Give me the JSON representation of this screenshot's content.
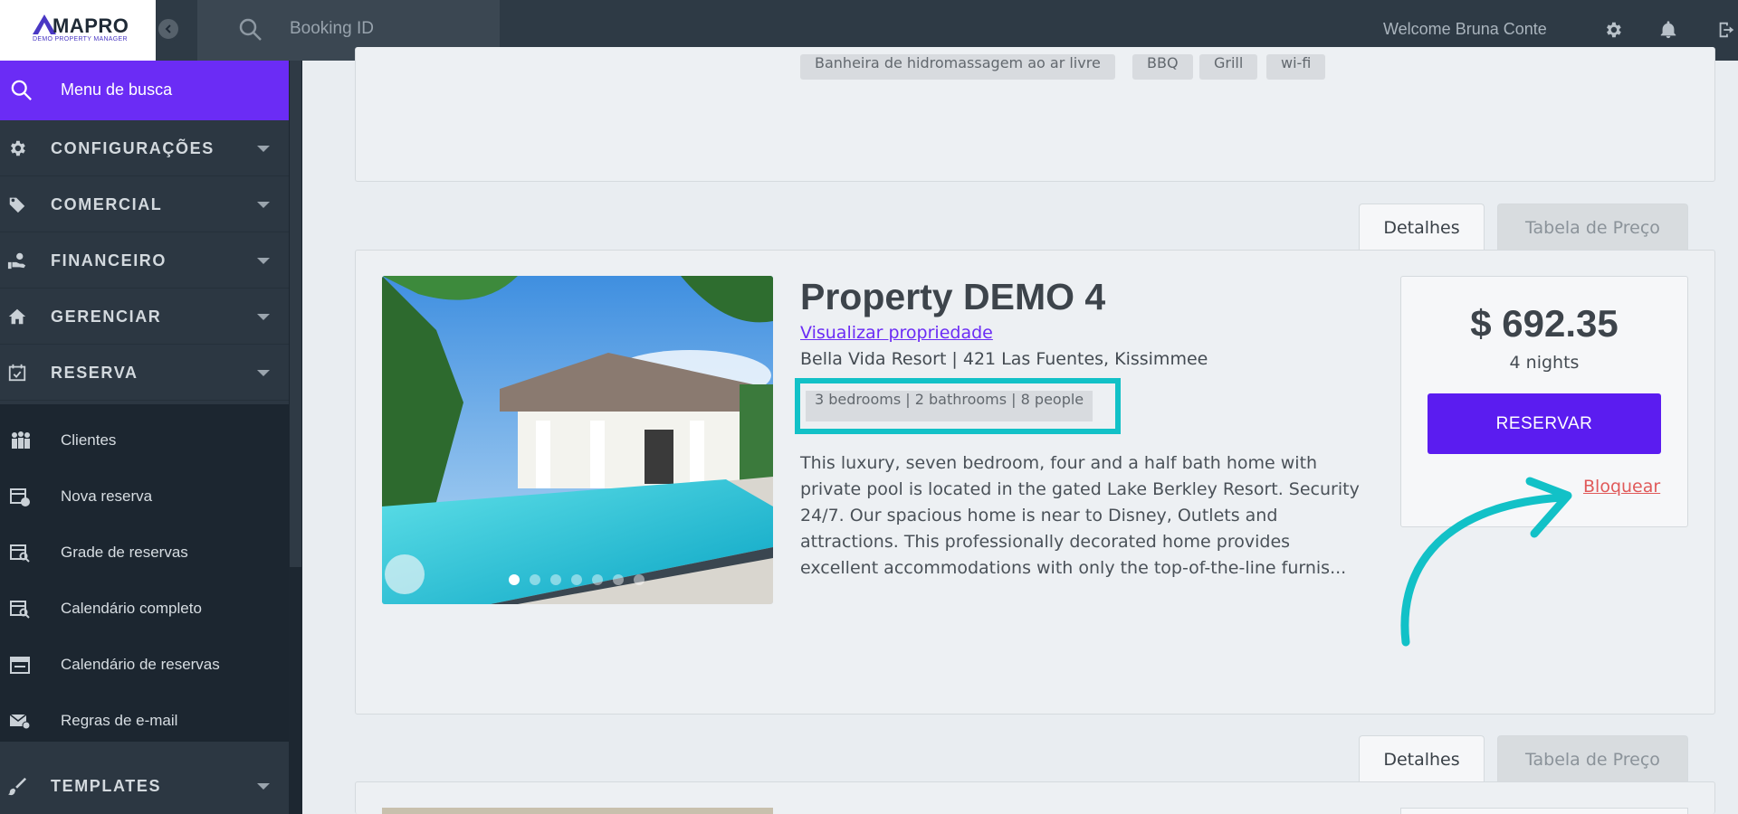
{
  "app": {
    "logo_text": "MAPRO",
    "logo_sub": "DEMO PROPERTY MANAGER",
    "search_placeholder": "Booking ID",
    "welcome": "Welcome Bruna Conte"
  },
  "sidebar": {
    "search_label": "Menu de busca",
    "sections": [
      {
        "label": "CONFIGURAÇÕES",
        "icon": "gear-icon"
      },
      {
        "label": "COMERCIAL",
        "icon": "tag-icon"
      },
      {
        "label": "FINANCEIRO",
        "icon": "money-hand-icon"
      },
      {
        "label": "GERENCIAR",
        "icon": "house-icon"
      },
      {
        "label": "RESERVA",
        "icon": "calendar-check-icon"
      }
    ],
    "sub_items": [
      {
        "label": "Clientes",
        "icon": "people-icon"
      },
      {
        "label": "Nova reserva",
        "icon": "calendar-plus-icon"
      },
      {
        "label": "Grade de reservas",
        "icon": "calendar-search-icon"
      },
      {
        "label": "Calendário completo",
        "icon": "calendar-search-icon"
      },
      {
        "label": "Calendário de reservas",
        "icon": "calendar-icon"
      },
      {
        "label": "Regras de e-mail",
        "icon": "email-icon"
      }
    ],
    "templates": {
      "label": "TEMPLATES",
      "icon": "brush-icon"
    }
  },
  "prev_card": {
    "amenities": [
      "Banheira de hidromassagem ao ar livre",
      "BBQ",
      "Grill",
      "wi-fi"
    ]
  },
  "tabs": {
    "details": "Detalhes",
    "price_table": "Tabela de Preço"
  },
  "property": {
    "title": "Property DEMO 4",
    "link": "Visualizar propriedade",
    "address": "Bella Vida Resort | 421 Las Fuentes, Kissimmee",
    "specs": "3 bedrooms | 2 bathrooms | 8 people",
    "description": "This luxury, seven bedroom, four and a half bath home with private pool is located in the gated Lake Berkley Resort. Security 24/7. Our spacious home is near to Disney, Outlets and attractions. This professionally decorated home provides excellent accommodations with only the top-of-the-line furnis...",
    "price": "$ 692.35",
    "nights": "4 nights",
    "reserve_label": "RESERVAR",
    "block_label": "Bloquear",
    "carousel_count": 7
  },
  "colors": {
    "accent": "#5b1cf0",
    "highlight": "#12c1c7",
    "danger": "#e05a5a"
  }
}
